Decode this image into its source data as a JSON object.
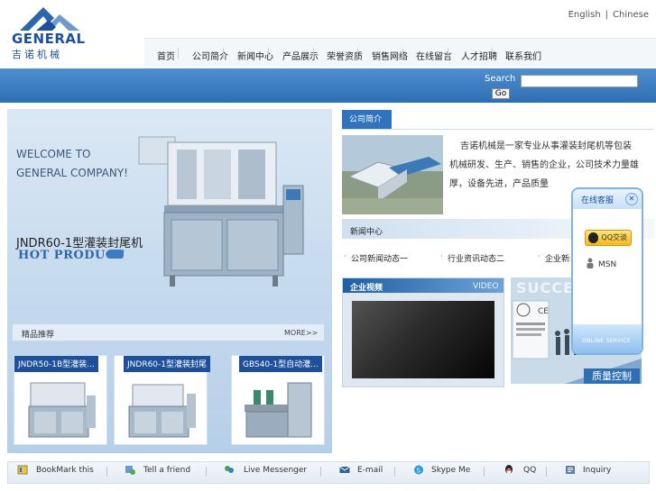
{
  "header": {
    "logo_text": "GENERAL",
    "logo_cn": "吉诺机械",
    "lang": [
      "English",
      "Chinese"
    ]
  },
  "nav": {
    "items": [
      "首页",
      "公司简介",
      "新闻中心",
      "产品展示",
      "荣誉资质",
      "销售网络",
      "在线留言",
      "人才招聘",
      "联系我们"
    ]
  },
  "search": {
    "label": "Search",
    "button": "Go",
    "value": ""
  },
  "banner": {
    "welcome": [
      "WELCOME TO",
      "GENERAL COMPANY!"
    ],
    "model": "JNDR60-1型灌装封尾机",
    "hot": "HOT PRODUCT"
  },
  "products": {
    "title": "精品推荐",
    "more": "MORE>>",
    "items": [
      {
        "label": "JNDR50-1B型灌装..."
      },
      {
        "label": "JNDR60-1型灌装封尾"
      },
      {
        "label": "GBS40-1型自动灌..."
      }
    ]
  },
  "about": {
    "tab": "公司简介",
    "text": "吉诺机械是一家专业从事灌装封尾机等包装机械研发、生产、销售的企业，公司技术力量雄厚，设备先进，产品质量"
  },
  "news": {
    "title": "新闻中心",
    "items": [
      "公司新闻动态一",
      "行业资讯动态二",
      "企业新闻"
    ]
  },
  "video": {
    "title": "企业视频",
    "en": "VIDEO"
  },
  "quality": {
    "label": "质量控制",
    "banner": "SUCCE"
  },
  "chat": {
    "title": "在线客服",
    "qq": "QQ交谈",
    "msn": "MSN",
    "footer": "ONLINE SERVICE"
  },
  "footer": {
    "items": [
      "BookMark this",
      "Tell a friend",
      "Live Messenger",
      "E-mail",
      "Skype Me",
      "QQ",
      "Inquiry"
    ]
  }
}
